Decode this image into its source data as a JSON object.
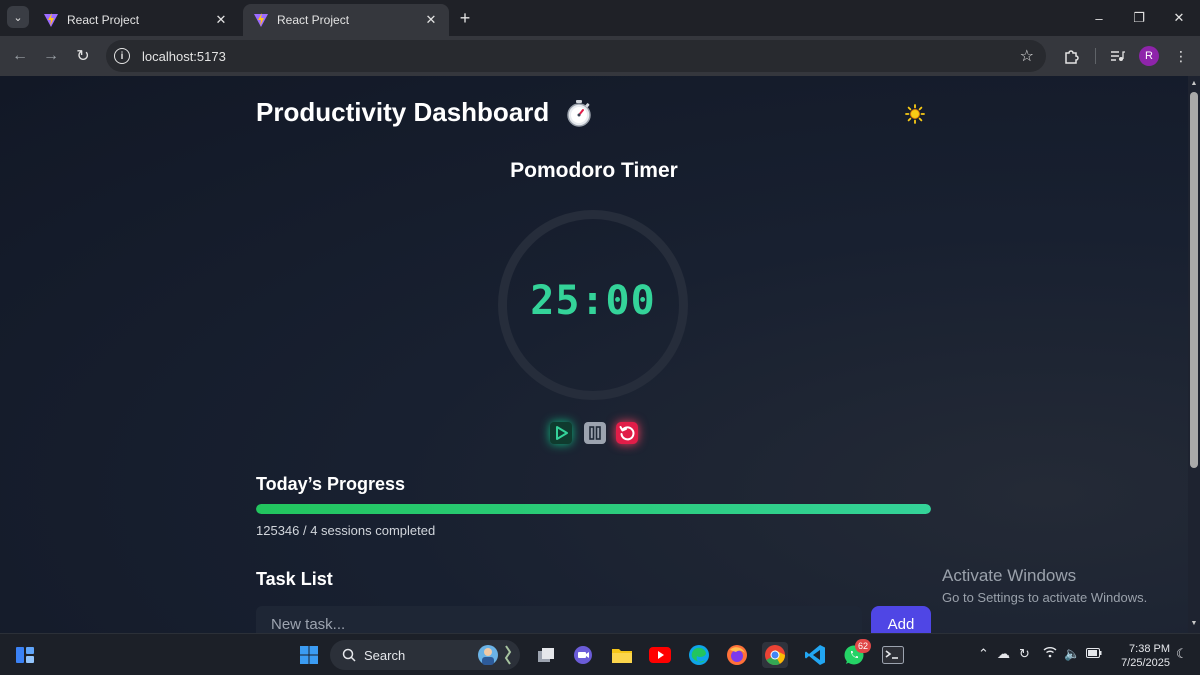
{
  "browser": {
    "tabs": [
      {
        "title": "React Project",
        "active": false
      },
      {
        "title": "React Project",
        "active": true
      }
    ],
    "url": "localhost:5173",
    "profile_initial": "R"
  },
  "dashboard": {
    "title": "Productivity Dashboard",
    "title_icon": "stopwatch-icon",
    "theme_icon": "sun-icon"
  },
  "pomodoro": {
    "title": "Pomodoro Timer",
    "time": "25:00",
    "controls": [
      "play-icon",
      "pause-icon",
      "reset-icon"
    ],
    "accent_color": "#34d399"
  },
  "progress": {
    "title": "Today’s Progress",
    "summary": "125346 / 4 sessions completed",
    "fill_fraction": 1.0,
    "bar_color": "#22c55e"
  },
  "tasks": {
    "title": "Task List",
    "input_placeholder": "New task...",
    "input_value": "",
    "add_label": "Add",
    "add_color": "#4f46e5"
  },
  "watermark": {
    "line1": "Activate Windows",
    "line2": "Go to Settings to activate Windows."
  },
  "taskbar": {
    "search_label": "Search",
    "whatsapp_badge": "62",
    "time": "7:38 PM",
    "date": "7/25/2025"
  }
}
